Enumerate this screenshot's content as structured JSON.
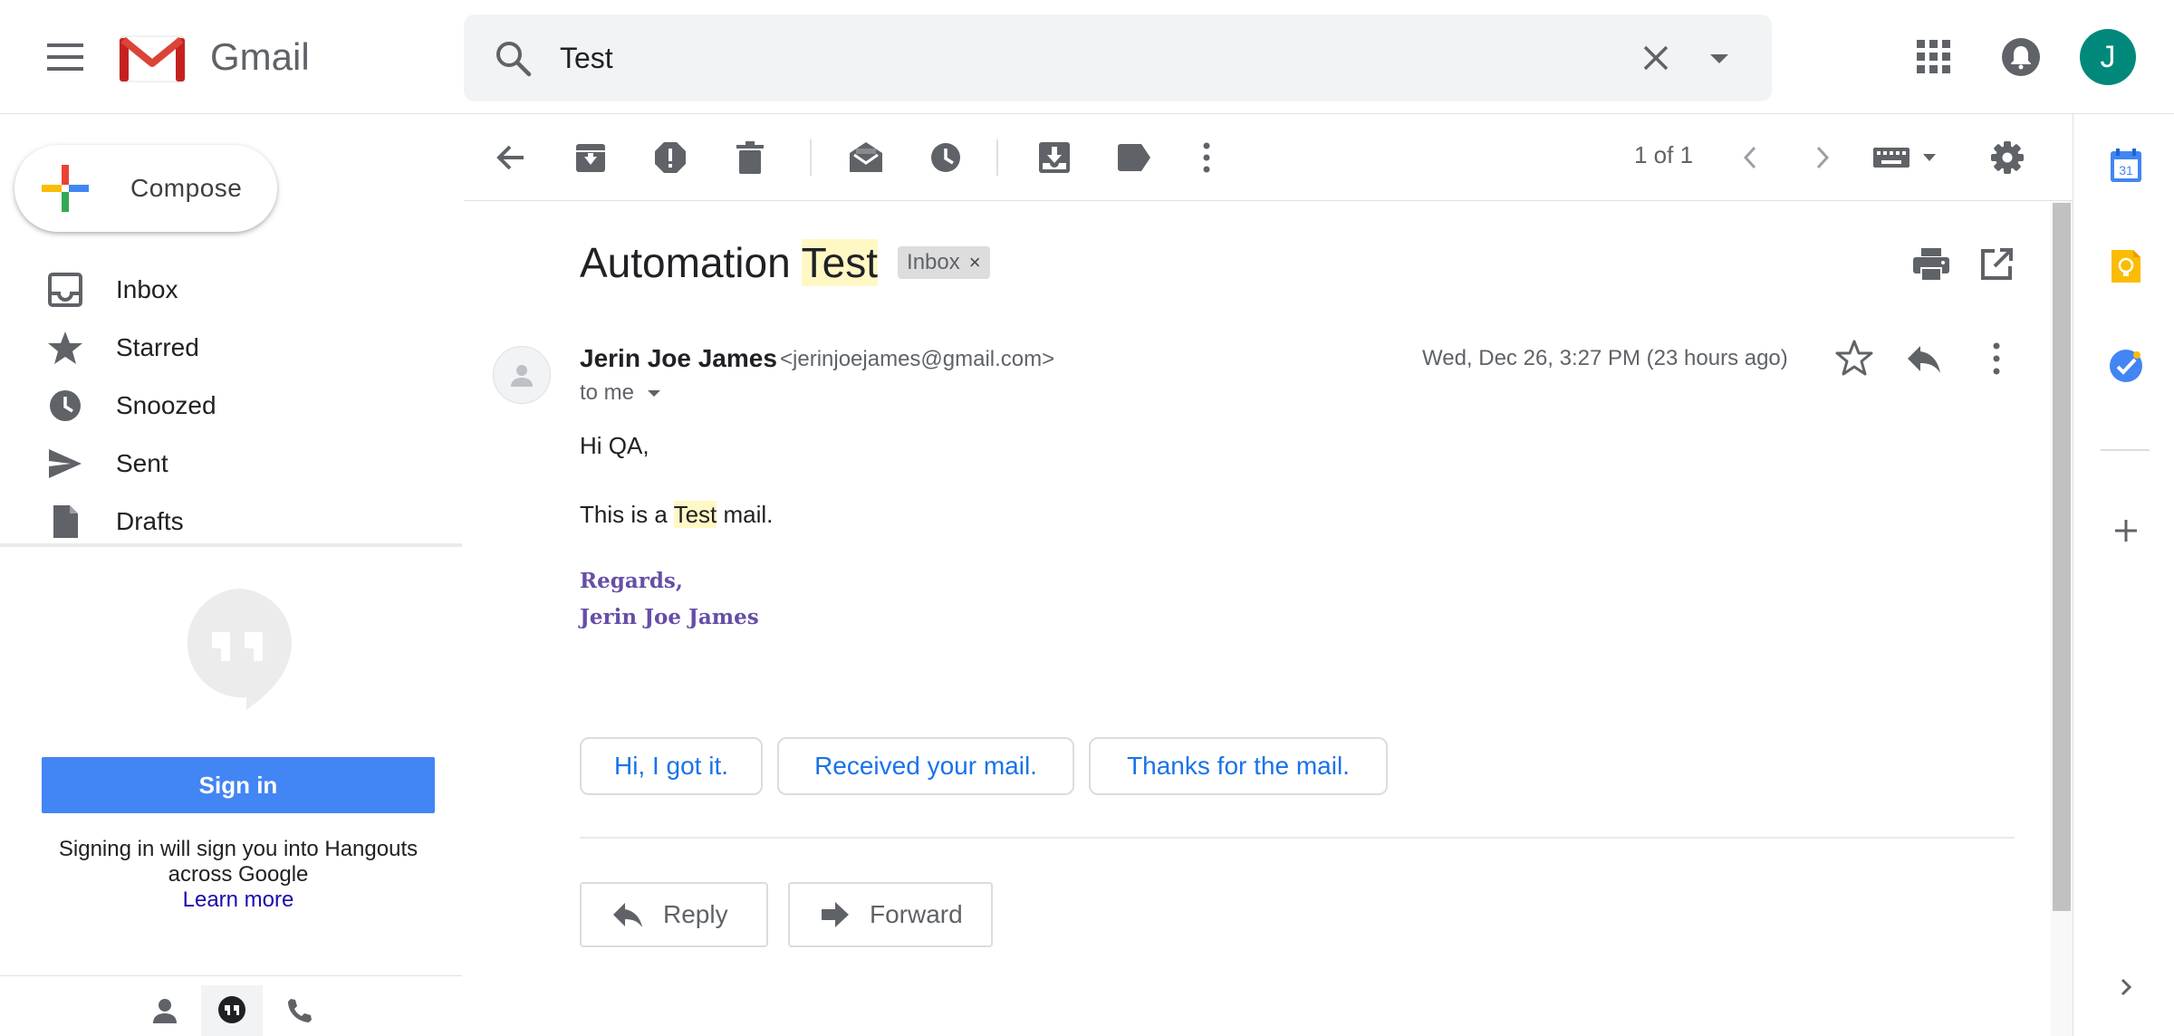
{
  "header": {
    "brand": "Gmail",
    "search_value": "Test",
    "avatar_initial": "J"
  },
  "sidebar": {
    "compose_label": "Compose",
    "items": [
      {
        "label": "Inbox",
        "icon": "inbox-icon"
      },
      {
        "label": "Starred",
        "icon": "star-icon"
      },
      {
        "label": "Snoozed",
        "icon": "clock-icon"
      },
      {
        "label": "Sent",
        "icon": "send-icon"
      },
      {
        "label": "Drafts",
        "icon": "draft-icon"
      }
    ]
  },
  "hangouts": {
    "signin_label": "Sign in",
    "text": "Signing in will sign you into Hangouts across Google",
    "learn_more": "Learn more"
  },
  "toolbar": {
    "pager": "1 of 1"
  },
  "message": {
    "subject_prefix": "Automation",
    "subject_highlight": "Test",
    "label": "Inbox",
    "label_remove": "×",
    "sender_name": "Jerin Joe James",
    "sender_email": "<jerinjoejames@gmail.com>",
    "to": "to me",
    "date": "Wed, Dec 26, 3:27 PM (23 hours ago)",
    "greeting": "Hi QA,",
    "body_pre": "This is a",
    "body_highlight": "Test",
    "body_post": "mail.",
    "signature_line1": "Regards,",
    "signature_line2": "Jerin Joe James"
  },
  "smart_replies": [
    "Hi, I got it.",
    "Received your mail.",
    "Thanks for the mail."
  ],
  "actions": {
    "reply": "Reply",
    "forward": "Forward"
  },
  "rail": {
    "calendar_day": "31"
  },
  "colors": {
    "accent_blue": "#4285f4",
    "link_blue": "#1a73e8",
    "avatar_teal": "#00897b",
    "signature_purple": "#674ea7",
    "search_highlight": "#fff8c5"
  }
}
